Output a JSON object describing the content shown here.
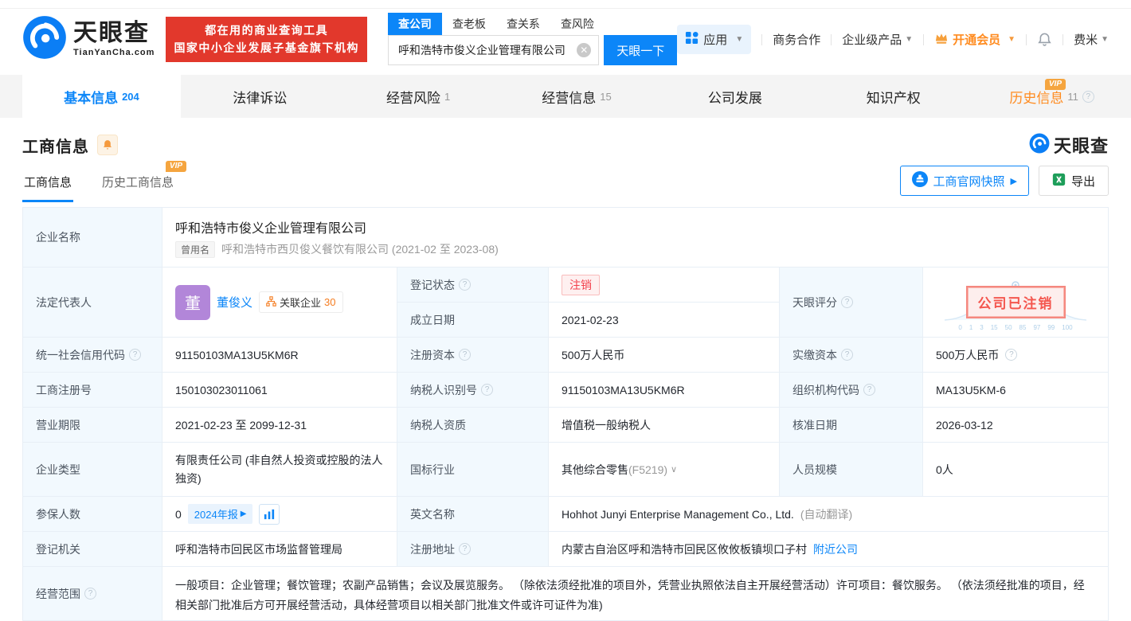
{
  "header": {
    "logo": {
      "title": "天眼查",
      "subtitle": "TianYanCha.com"
    },
    "banner": {
      "line1": "都在用的商业查询工具",
      "line2": "国家中小企业发展子基金旗下机构"
    },
    "search": {
      "tabs": [
        {
          "label": "查公司"
        },
        {
          "label": "查老板"
        },
        {
          "label": "查关系"
        },
        {
          "label": "查风险"
        }
      ],
      "value": "呼和浩特市俊义企业管理有限公司",
      "button": "天眼一下"
    },
    "nav": {
      "apps": "应用",
      "cooperation": "商务合作",
      "enterprise": "企业级产品",
      "vip": "开通会员",
      "user": "费米"
    }
  },
  "tabs": [
    {
      "label": "基本信息",
      "count": "204"
    },
    {
      "label": "法律诉讼",
      "count": ""
    },
    {
      "label": "经营风险",
      "count": "1"
    },
    {
      "label": "经营信息",
      "count": "15"
    },
    {
      "label": "公司发展",
      "count": ""
    },
    {
      "label": "知识产权",
      "count": ""
    },
    {
      "label": "历史信息",
      "count": "11",
      "vip": "VIP"
    }
  ],
  "section": {
    "title": "工商信息",
    "watermark": "天眼查",
    "subtabs": [
      {
        "label": "工商信息"
      },
      {
        "label": "历史工商信息",
        "vip": "VIP"
      }
    ],
    "snapshot_button": "工商官网快照",
    "export_button": "导出"
  },
  "table": {
    "company_name": {
      "label": "企业名称",
      "value": "呼和浩特市俊义企业管理有限公司",
      "former_label": "曾用名",
      "former_value": "呼和浩特市西贝俊义餐饮有限公司 (2021-02 至 2023-08)"
    },
    "legal_rep": {
      "label": "法定代表人",
      "avatar": "董",
      "name": "董俊义",
      "related_label": "关联企业",
      "related_count": "30"
    },
    "reg_status": {
      "label": "登记状态",
      "value": "注销"
    },
    "establish_date": {
      "label": "成立日期",
      "value": "2021-02-23"
    },
    "tyc_score": {
      "label": "天眼评分",
      "stamp": "公司已注销",
      "scale": [
        "0",
        "1",
        "3",
        "15",
        "50",
        "85",
        "97",
        "99",
        "100"
      ]
    },
    "credit_code": {
      "label": "统一社会信用代码",
      "value": "91150103MA13U5KM6R"
    },
    "reg_capital": {
      "label": "注册资本",
      "value": "500万人民币"
    },
    "paid_capital": {
      "label": "实缴资本",
      "value": "500万人民币"
    },
    "reg_number": {
      "label": "工商注册号",
      "value": "150103023011061"
    },
    "taxpayer_id": {
      "label": "纳税人识别号",
      "value": "91150103MA13U5KM6R"
    },
    "org_code": {
      "label": "组织机构代码",
      "value": "MA13U5KM-6"
    },
    "business_term": {
      "label": "营业期限",
      "value": "2021-02-23 至 2099-12-31"
    },
    "taxpayer_quality": {
      "label": "纳税人资质",
      "value": "增值税一般纳税人"
    },
    "approval_date": {
      "label": "核准日期",
      "value": "2026-03-12"
    },
    "company_type": {
      "label": "企业类型",
      "value": "有限责任公司 (非自然人投资或控股的法人独资)"
    },
    "industry": {
      "label": "国标行业",
      "value": "其他综合零售",
      "code": "(F5219)"
    },
    "staff_size": {
      "label": "人员规模",
      "value": "0人"
    },
    "insured": {
      "label": "参保人数",
      "value": "0",
      "report_badge": "2024年报"
    },
    "english_name": {
      "label": "英文名称",
      "value": "Hohhot Junyi Enterprise Management Co., Ltd.",
      "note": "(自动翻译)"
    },
    "reg_authority": {
      "label": "登记机关",
      "value": "呼和浩特市回民区市场监督管理局"
    },
    "address": {
      "label": "注册地址",
      "value": "内蒙古自治区呼和浩特市回民区攸攸板镇坝口子村",
      "link": "附近公司"
    },
    "business_scope": {
      "label": "经营范围",
      "value": "一般项目：企业管理；餐饮管理；农副产品销售；会议及展览服务。 （除依法须经批准的项目外，凭营业执照依法自主开展经营活动）许可项目：餐饮服务。 （依法须经批准的项目，经相关部门批准后方可开展经营活动，具体经营项目以相关部门批准文件或许可证件为准)"
    }
  }
}
